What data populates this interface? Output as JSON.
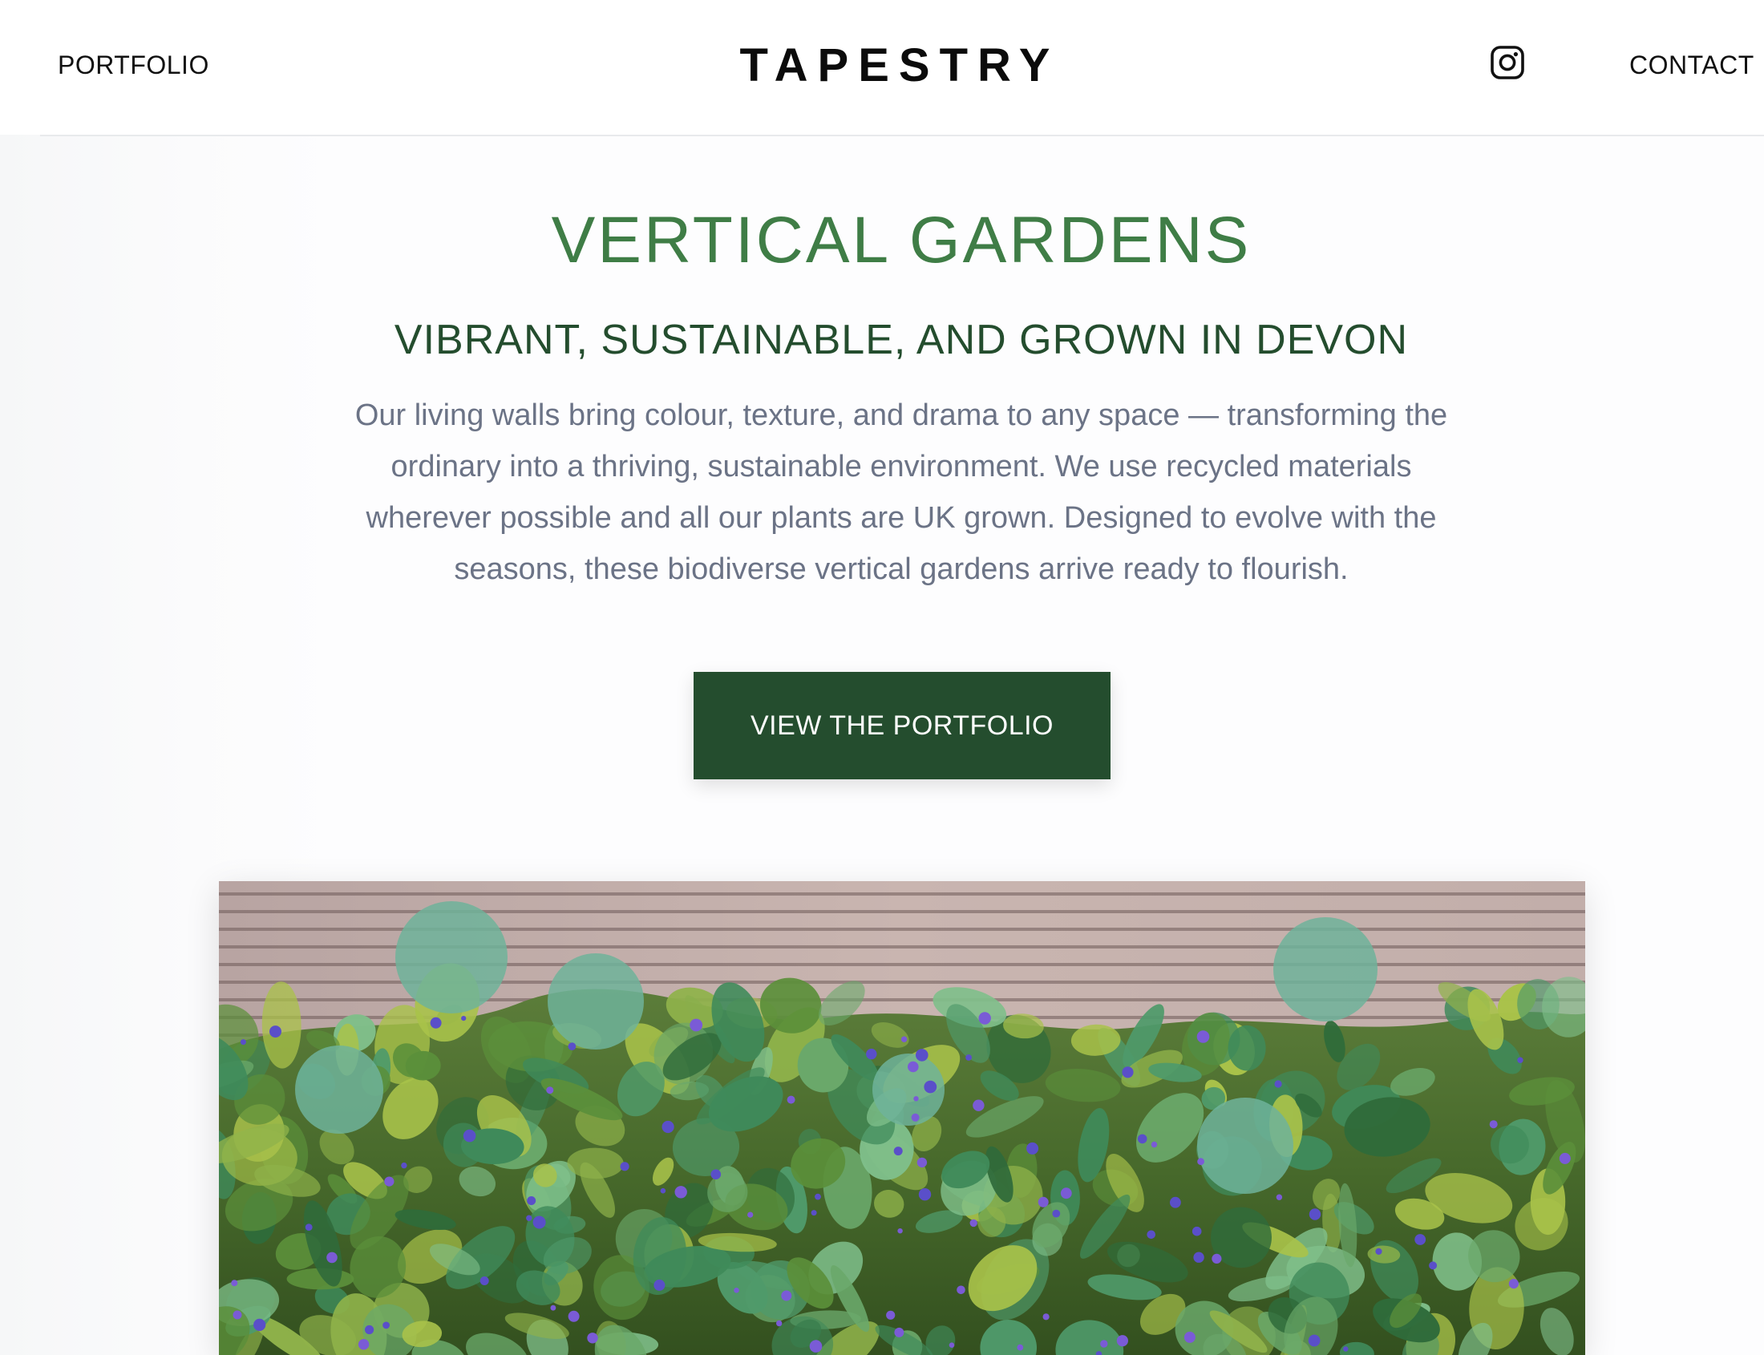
{
  "nav": {
    "left_link": "PORTFOLIO",
    "brand": "TAPESTRY",
    "right_link": "CONTACT",
    "social_icon": "instagram-icon"
  },
  "hero": {
    "title": "VERTICAL GARDENS",
    "subtitle": "VIBRANT, SUSTAINABLE, AND GROWN IN DEVON",
    "body": "Our living walls bring colour, texture, and drama to any space — transforming the ordinary into a thriving, sustainable environment. We use recycled materials wherever possible and all our plants are UK grown. Designed to evolve with the seasons, these biodiverse vertical gardens arrive ready to flourish.",
    "cta_label": "VIEW THE PORTFOLIO"
  },
  "photo": {
    "subject": "vertical garden with leafy plants and purple flowers in front of a slatted wooden fence"
  },
  "colors": {
    "title_green": "#3f7d46",
    "subtitle_green": "#244d2e",
    "button_green": "#244d2e",
    "body_text": "#6b7386",
    "brand_text": "#0b0b0b"
  }
}
